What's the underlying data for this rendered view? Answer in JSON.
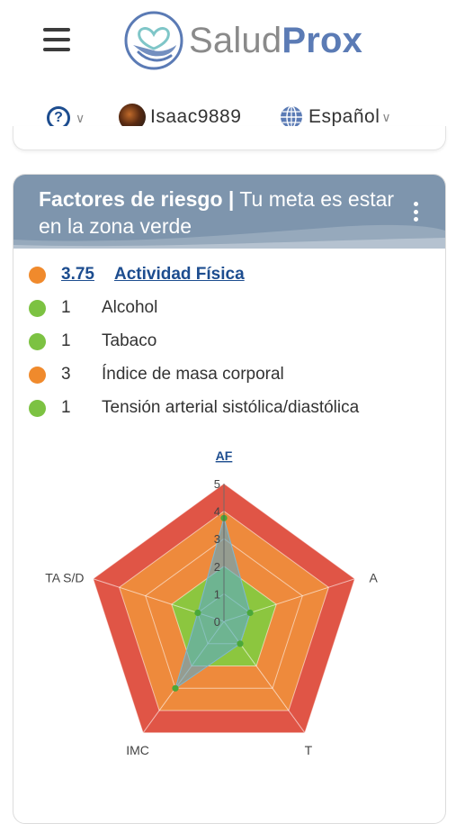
{
  "header": {
    "logo_text_light": "Salud",
    "logo_text_bold": "Prox"
  },
  "userbar": {
    "help_glyph": "?",
    "username": "Isaac9889",
    "language": "Español"
  },
  "risk_card": {
    "title_bold": "Factores de riesgo |",
    "title_light": " Tu meta es estar en la zona verde",
    "factors": [
      {
        "value": "3.75",
        "label": "Actividad Física",
        "status": "orange",
        "active": true
      },
      {
        "value": "1",
        "label": "Alcohol",
        "status": "green",
        "active": false
      },
      {
        "value": "1",
        "label": "Tabaco",
        "status": "green",
        "active": false
      },
      {
        "value": "3",
        "label": "Índice de masa corporal",
        "status": "orange",
        "active": false
      },
      {
        "value": "1",
        "label": "Tensión arterial sistólica/diastólica",
        "status": "green",
        "active": false
      }
    ]
  },
  "chart_data": {
    "type": "radar",
    "axes": [
      "AF",
      "A",
      "T",
      "IMC",
      "TA S/D"
    ],
    "values": [
      3.75,
      1,
      1,
      3,
      1
    ],
    "range": [
      0,
      5
    ],
    "ring_labels": [
      "0",
      "1",
      "2",
      "3",
      "4",
      "5"
    ],
    "zone_colors": {
      "red": "#e05546",
      "orange": "#ee8a3c",
      "green": "#8cc63f",
      "series_fill": "#5aa9c8",
      "point": "#4aa83a"
    }
  },
  "colors": {
    "status_orange": "#f08a2c",
    "status_green": "#7cc242",
    "link_blue": "#1d4d8f",
    "brand_blue": "#5b7bb5",
    "card_header": "#7e95ad"
  }
}
